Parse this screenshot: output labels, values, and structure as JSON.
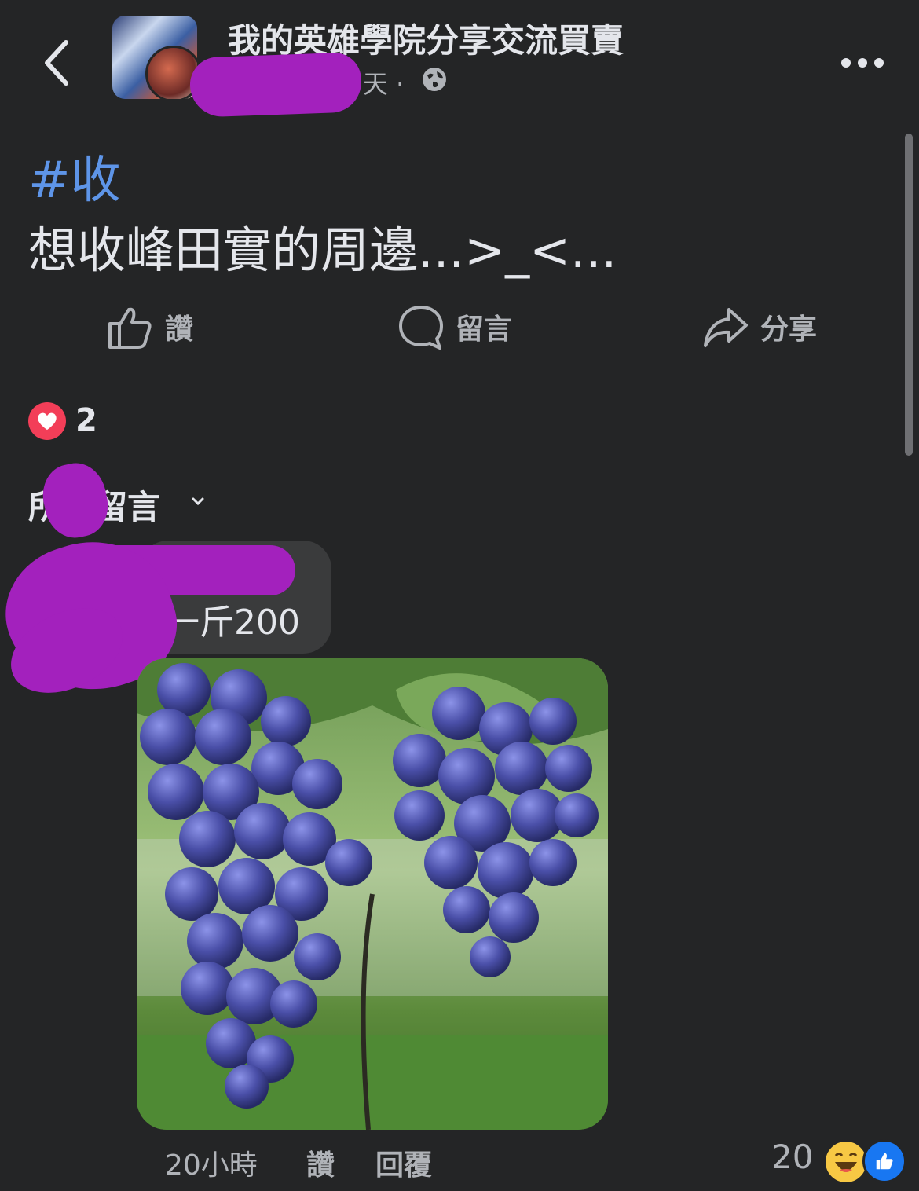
{
  "header": {
    "group_name": "我的英雄學院分享交流買賣",
    "time_suffix": "天 ·",
    "back_icon": "chevron-left-icon",
    "privacy_icon": "globe-icon",
    "more_icon": "more-icon"
  },
  "post": {
    "hashtag": "#收",
    "text": "想收峰田實的周邊...>_<..."
  },
  "actions": {
    "like": "讚",
    "comment": "留言",
    "share": "分享"
  },
  "reactions": {
    "icon": "heart-icon",
    "count": "2"
  },
  "comments_sort": {
    "label": "所有留言",
    "chevron": "chevron-down-icon"
  },
  "comment": {
    "text": "一斤200",
    "image_desc": "grapes-photo",
    "time": "20小時",
    "like": "讚",
    "reply": "回覆",
    "reaction_count": "20"
  },
  "colors": {
    "background": "#242526",
    "accent": "#5e95e8",
    "redaction": "#a321bd"
  }
}
